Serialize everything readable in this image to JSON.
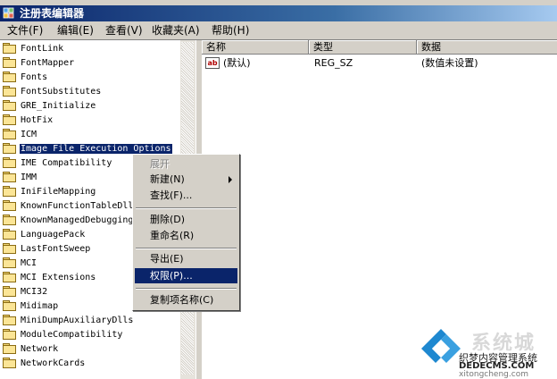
{
  "window": {
    "clipped_top_text": "",
    "title": "注册表编辑器"
  },
  "menubar": {
    "items": [
      {
        "label": "文件(F)"
      },
      {
        "label": "编辑(E)"
      },
      {
        "label": "查看(V)"
      },
      {
        "label": "收藏夹(A)"
      },
      {
        "label": "帮助(H)"
      }
    ]
  },
  "tree": {
    "items": [
      "FontLink",
      "FontMapper",
      "Fonts",
      "FontSubstitutes",
      "GRE_Initialize",
      "HotFix",
      "ICM",
      "Image File Execution Options",
      "IME Compatibility",
      "IMM",
      "IniFileMapping",
      "KnownFunctionTableDlls",
      "KnownManagedDebuggingDlls",
      "LanguagePack",
      "LastFontSweep",
      "MCI",
      "MCI Extensions",
      "MCI32",
      "Midimap",
      "MiniDumpAuxiliaryDlls",
      "ModuleCompatibility",
      "Network",
      "NetworkCards"
    ],
    "selected": "Image File Execution Options"
  },
  "list": {
    "columns": {
      "name": "名称",
      "type": "类型",
      "data": "数据"
    },
    "rows": [
      {
        "name": "(默认)",
        "type": "REG_SZ",
        "data": "(数值未设置)",
        "icon": "string-value-icon"
      }
    ]
  },
  "context_menu": {
    "expand": "展开",
    "new": "新建(N)",
    "find": "查找(F)...",
    "delete": "删除(D)",
    "rename": "重命名(R)",
    "export": "导出(E)",
    "permissions": "权限(P)...",
    "copy_key_name": "复制项名称(C)",
    "highlighted": "权限(P)..."
  },
  "watermark": {
    "brand": "系统城",
    "line1": "织梦内容管理系统",
    "line2": "DEDECMS.COM",
    "line3": "xitongcheng.com"
  },
  "colors": {
    "title_start": "#0a246a",
    "title_end": "#a6caf0",
    "chrome": "#d4d0c8",
    "selection": "#0a246a",
    "watermark_blue": "#1e88d0"
  }
}
